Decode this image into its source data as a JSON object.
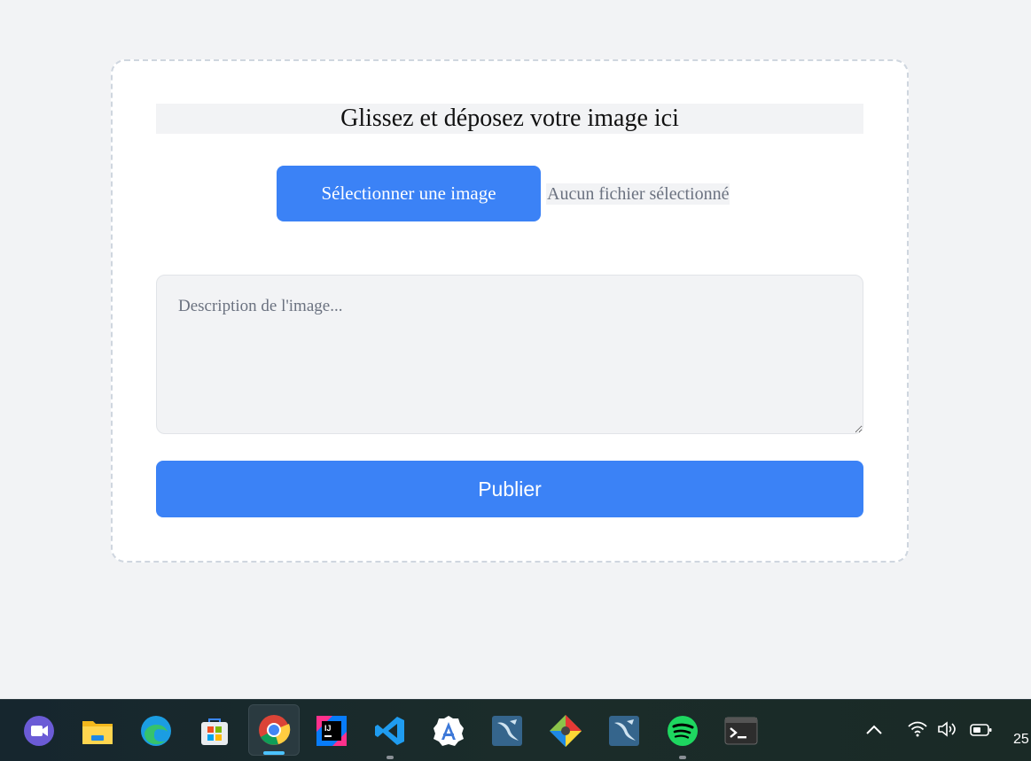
{
  "upload": {
    "drop_title": "Glissez et déposez votre image ici",
    "select_button": "Sélectionner une image",
    "file_status": "Aucun fichier sélectionné",
    "description_placeholder": "Description de l'image...",
    "description_value": "",
    "publish_button": "Publier"
  },
  "colors": {
    "accent": "#3b82f6",
    "background": "#f2f3f5",
    "card": "#ffffff"
  },
  "taskbar": {
    "apps": [
      {
        "name": "video-app-icon"
      },
      {
        "name": "file-explorer-icon"
      },
      {
        "name": "edge-browser-icon"
      },
      {
        "name": "microsoft-store-icon"
      },
      {
        "name": "chrome-icon",
        "active": true
      },
      {
        "name": "intellij-icon"
      },
      {
        "name": "vscode-icon"
      },
      {
        "name": "android-studio-icon"
      },
      {
        "name": "mysql-workbench-icon"
      },
      {
        "name": "git-icon"
      },
      {
        "name": "mysql-workbench-icon-2"
      },
      {
        "name": "spotify-icon"
      },
      {
        "name": "terminal-icon"
      }
    ],
    "clock_partial": "25"
  }
}
